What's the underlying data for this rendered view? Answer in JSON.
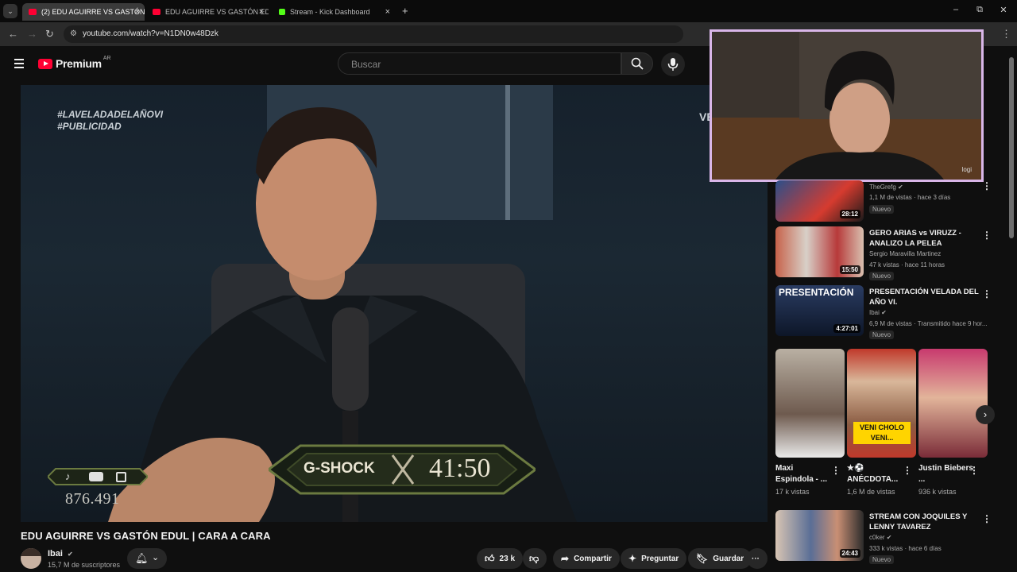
{
  "browser": {
    "tabs": [
      {
        "label": "(2) EDU AGUIRRE VS GASTÓN E",
        "active": true,
        "favicon_color": "#ff0033"
      },
      {
        "label": "EDU AGUIRRE VS GASTÓN EDU",
        "active": false,
        "favicon_color": "#ff0033"
      },
      {
        "label": "Stream - Kick Dashboard",
        "active": false,
        "favicon_color": "#53fc18"
      }
    ],
    "new_tab": "+",
    "url": "youtube.com/watch?v=N1DN0w48Dzk",
    "window_buttons": [
      "–",
      "⧉",
      "✕"
    ]
  },
  "header": {
    "logo_text": "Premium",
    "country": "AR",
    "search_placeholder": "Buscar"
  },
  "video": {
    "overlay_hashtag_1": "#LAVELADADELAÑOVI",
    "overlay_hashtag_2": "#PUBLICIDAD",
    "sponsor": "G-SHOCK",
    "timer": "41:50",
    "viewer_count": "876.491",
    "edge_text": "VE",
    "cam_label": "logi"
  },
  "watch": {
    "title": "EDU AGUIRRE VS GASTÓN EDUL | CARA A CARA",
    "channel": "Ibai",
    "subscribers": "15,7 M de suscriptores",
    "likes": "23 k",
    "share": "Compartir",
    "ask": "Preguntar",
    "save": "Guardar",
    "more": "···"
  },
  "sidebar": {
    "videos": [
      {
        "title": "",
        "channel": "TheGrefg ✔",
        "meta": "1,1 M de vistas · hace 3 días",
        "badge": "Nuevo",
        "duration": "28:12"
      },
      {
        "title": "GERO ARIAS vs VIRUZZ - ANALIZO LA PELEA",
        "channel": "Sergio Maravilla Martinez",
        "meta": "47 k vistas · hace 11 horas",
        "badge": "Nuevo",
        "duration": "15:50"
      },
      {
        "title": "PRESENTACIÓN VELADA DEL AÑO VI.",
        "channel": "Ibai ✔",
        "meta": "6,9 M de vistas · Transmitido hace 9 hor...",
        "badge": "Nuevo",
        "duration": "4:27:01",
        "thumb_text": "PRESENTACIÓN"
      },
      {
        "title": "STREAM CON JOQUILES Y LENNY TAVAREZ",
        "channel": "c0ker ✔",
        "meta": "333 k vistas · hace 6 días",
        "badge": "Nuevo",
        "duration": "24:43"
      }
    ],
    "shorts": [
      {
        "title": "Maxi Espindola - ...",
        "views": "17 k vistas"
      },
      {
        "title": "★⚽ ANÉCDOTA...",
        "views": "1,6 M de vistas",
        "thumb_text": "VENI CHOLO VENI..."
      },
      {
        "title": "Justin Biebers ...",
        "views": "936 k vistas"
      }
    ]
  }
}
